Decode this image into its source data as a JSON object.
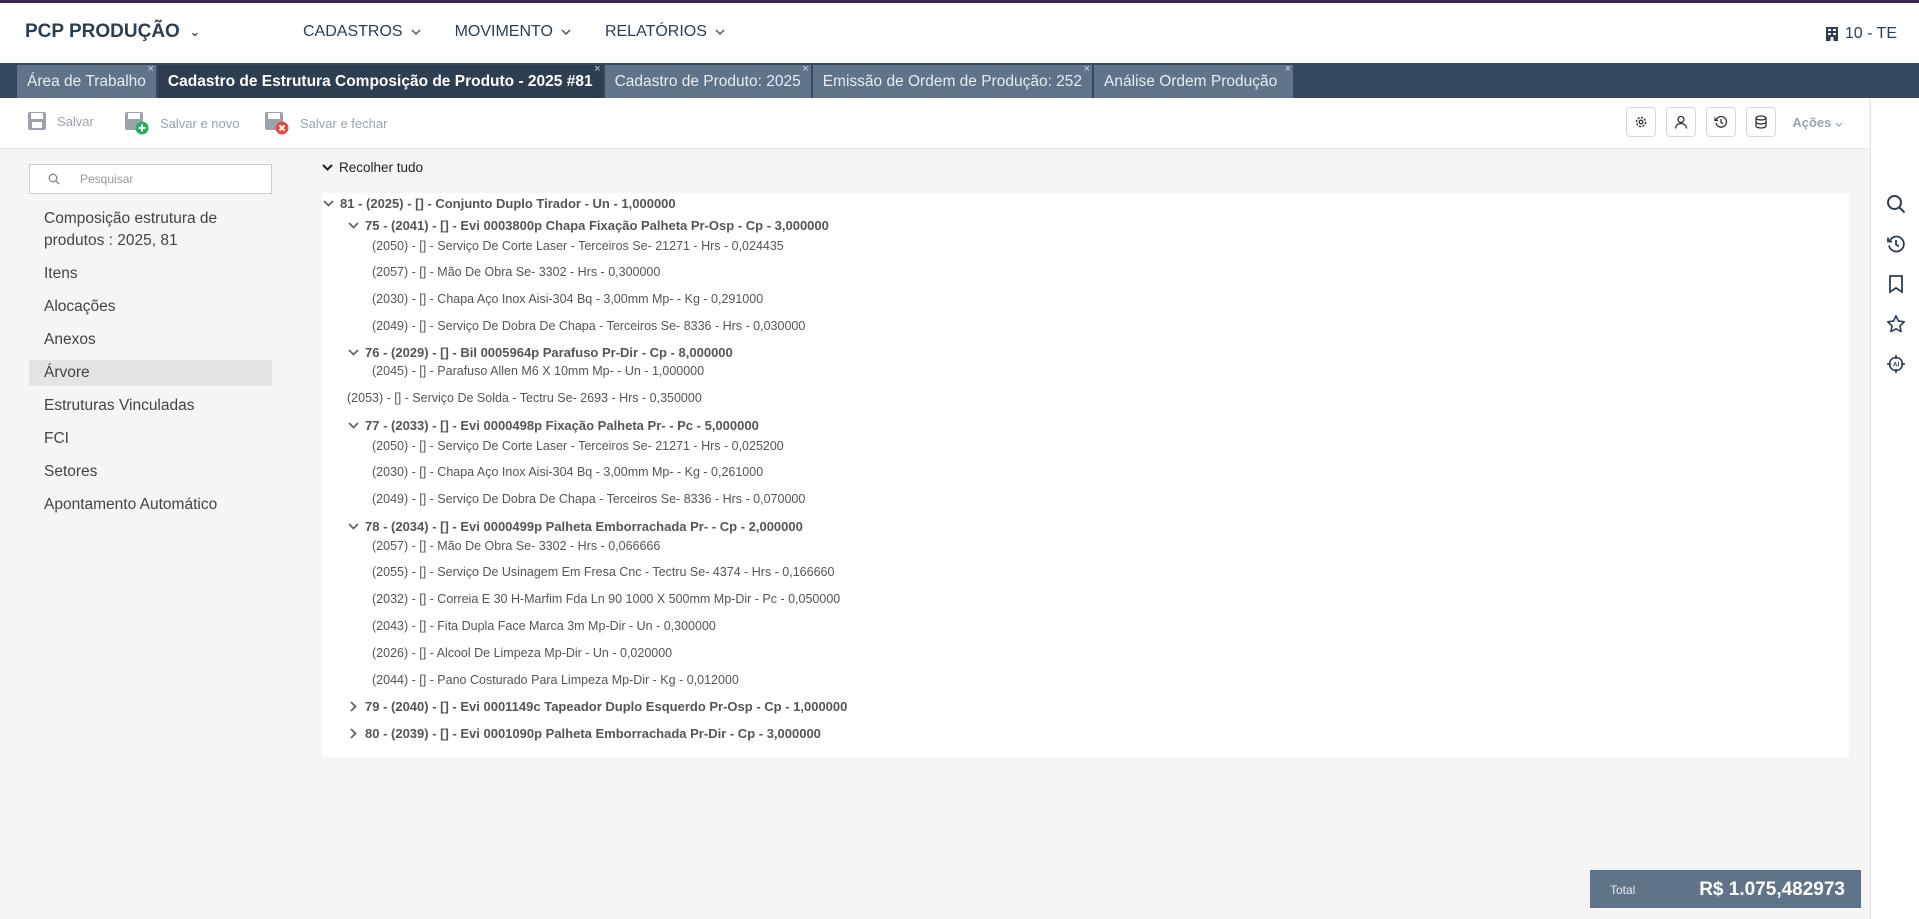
{
  "app": {
    "title": "PCP PRODUÇÃO",
    "company": "10 - TE"
  },
  "nav": [
    {
      "label": "CADASTROS"
    },
    {
      "label": "MOVIMENTO"
    },
    {
      "label": "RELATÓRIOS"
    }
  ],
  "tabs": [
    {
      "label": "Área de Trabalho"
    },
    {
      "label": "Cadastro de Estrutura Composição de Produto - 2025 #81"
    },
    {
      "label": "Cadastro de Produto: 2025"
    },
    {
      "label": "Emissão de Ordem de Produção: 252"
    },
    {
      "label": "Análise Ordem Produção"
    }
  ],
  "tab_close": "×",
  "toolbar": {
    "save": "Salvar",
    "save_new": "Salvar e novo",
    "save_close": "Salvar e fechar",
    "actions": "Ações"
  },
  "search": {
    "placeholder": "Pesquisar"
  },
  "sidebar": [
    {
      "label": "Composição estrutura de produtos : 2025, 81"
    },
    {
      "label": "Itens"
    },
    {
      "label": "Alocações"
    },
    {
      "label": "Anexos"
    },
    {
      "label": "Árvore"
    },
    {
      "label": "Estruturas Vinculadas"
    },
    {
      "label": "FCI"
    },
    {
      "label": "Setores"
    },
    {
      "label": "Apontamento Automático"
    }
  ],
  "tree": {
    "collapse_all": "Recolher tudo",
    "nodes": [
      {
        "text": "81 - (2025) - [] - Conjunto Duplo Tirador - Un - 1,000000",
        "level": 0,
        "toggle": "open",
        "bold": true
      },
      {
        "text": "75 - (2041) - [] - Evi 0003800p Chapa Fixação Palheta Pr-Osp - Cp - 3,000000",
        "level": 1,
        "toggle": "open",
        "bold": true
      },
      {
        "text": "(2050) - [] - Serviço De Corte Laser - Terceiros Se- 21271 - Hrs - 0,024435",
        "level": 2,
        "toggle": "none",
        "bold": false
      },
      {
        "text": "(2057) - [] - Mão De Obra Se- 3302 - Hrs - 0,300000",
        "level": 2,
        "toggle": "none",
        "bold": false
      },
      {
        "text": "(2030) - [] - Chapa Aço Inox Aisi-304 Bq - 3,00mm Mp- - Kg - 0,291000",
        "level": 2,
        "toggle": "none",
        "bold": false
      },
      {
        "text": "(2049) - [] - Serviço De Dobra De Chapa - Terceiros Se- 8336 - Hrs - 0,030000",
        "level": 2,
        "toggle": "none",
        "bold": false
      },
      {
        "text": "76 - (2029) - [] - Bil 0005964p Parafuso Pr-Dir - Cp - 8,000000",
        "level": 1,
        "toggle": "open",
        "bold": true
      },
      {
        "text": "(2045) - [] - Parafuso Allen M6 X 10mm Mp- - Un - 1,000000",
        "level": 2,
        "toggle": "none",
        "bold": false
      },
      {
        "text": "(2053) - [] - Serviço De Solda - Tectru Se- 2693 - Hrs - 0,350000",
        "level": 1,
        "toggle": "none",
        "bold": false
      },
      {
        "text": "77 - (2033) - [] - Evi 0000498p Fixação Palheta Pr- - Pc - 5,000000",
        "level": 1,
        "toggle": "open",
        "bold": true
      },
      {
        "text": "(2050) - [] - Serviço De Corte Laser - Terceiros Se- 21271 - Hrs - 0,025200",
        "level": 2,
        "toggle": "none",
        "bold": false
      },
      {
        "text": "(2030) - [] - Chapa Aço Inox Aisi-304 Bq - 3,00mm Mp- - Kg - 0,261000",
        "level": 2,
        "toggle": "none",
        "bold": false
      },
      {
        "text": "(2049) - [] - Serviço De Dobra De Chapa - Terceiros Se- 8336 - Hrs - 0,070000",
        "level": 2,
        "toggle": "none",
        "bold": false
      },
      {
        "text": "78 - (2034) - [] - Evi 0000499p Palheta Emborrachada Pr- - Cp - 2,000000",
        "level": 1,
        "toggle": "open",
        "bold": true
      },
      {
        "text": "(2057) - [] - Mão De Obra Se- 3302 - Hrs - 0,066666",
        "level": 2,
        "toggle": "none",
        "bold": false
      },
      {
        "text": "(2055) - [] - Serviço De Usinagem Em Fresa Cnc - Tectru Se- 4374 - Hrs - 0,166660",
        "level": 2,
        "toggle": "none",
        "bold": false
      },
      {
        "text": "(2032) - [] - Correia E 30 H-Marfim Fda Ln 90 1000 X 500mm Mp-Dir - Pc - 0,050000",
        "level": 2,
        "toggle": "none",
        "bold": false
      },
      {
        "text": "(2043) - [] - Fita Dupla Face Marca 3m Mp-Dir - Un - 0,300000",
        "level": 2,
        "toggle": "none",
        "bold": false
      },
      {
        "text": "(2026) - [] - Alcool De Limpeza Mp-Dir - Un - 0,020000",
        "level": 2,
        "toggle": "none",
        "bold": false
      },
      {
        "text": "(2044) - [] - Pano Costurado Para Limpeza Mp-Dir - Kg - 0,012000",
        "level": 2,
        "toggle": "none",
        "bold": false
      },
      {
        "text": "79 - (2040) - [] - Evi 0001149c Tapeador Duplo Esquerdo Pr-Osp - Cp - 1,000000",
        "level": 1,
        "toggle": "closed",
        "bold": true
      },
      {
        "text": "80 - (2039) - [] - Evi 0001090p Palheta Emborrachada Pr-Dir - Cp - 3,000000",
        "level": 1,
        "toggle": "closed",
        "bold": true
      }
    ]
  },
  "total": {
    "label": "Total",
    "value": "R$ 1.075,482973"
  },
  "colors": {
    "header_dark": "#34495e",
    "tab_inactive": "#5f7488",
    "tab_active": "#2c3e50",
    "selected_menu": "#e4e4e4",
    "save_new_badge": "#27ae60",
    "save_close_badge": "#e74c3c"
  }
}
